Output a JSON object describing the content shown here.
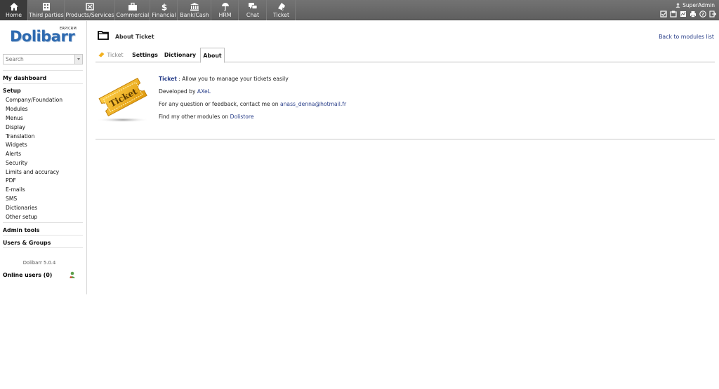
{
  "topmenu": [
    {
      "label": "Home",
      "icon": "home-icon",
      "active": true
    },
    {
      "label": "Third parties",
      "icon": "building-icon"
    },
    {
      "label": "Products/Services",
      "icon": "box-icon"
    },
    {
      "label": "Commercial",
      "icon": "briefcase-icon"
    },
    {
      "label": "Financial",
      "icon": "dollar-icon"
    },
    {
      "label": "Bank/Cash",
      "icon": "bank-icon"
    },
    {
      "label": "HRM",
      "icon": "umbrella-icon"
    },
    {
      "label": "Chat",
      "icon": "chat-icon"
    },
    {
      "label": "Ticket",
      "icon": "ticket-icon"
    }
  ],
  "user": {
    "name": "SuperAdmin"
  },
  "logo": {
    "brand": "Dolibarr",
    "tagline": "ERP/CRM"
  },
  "search": {
    "placeholder": "Search"
  },
  "leftmenu": {
    "dashboard": "My dashboard",
    "setup": "Setup",
    "setup_items": [
      "Company/Foundation",
      "Modules",
      "Menus",
      "Display",
      "Translation",
      "Widgets",
      "Alerts",
      "Security",
      "Limits and accuracy",
      "PDF",
      "E-mails",
      "SMS",
      "Dictionaries",
      "Other setup"
    ],
    "admin_tools": "Admin tools",
    "users_groups": "Users & Groups",
    "version": "Dolibarr 5.0.4",
    "online_users": "Online users (0)"
  },
  "page": {
    "title": "About Ticket",
    "back_link": "Back to modules list",
    "tabs": {
      "module": "Ticket",
      "settings": "Settings",
      "dictionary": "Dictionary",
      "about": "About"
    },
    "image_text": "Ticket",
    "info": {
      "module_name": "Ticket",
      "description": " : Allow you to manage your tickets easily",
      "developed_by": "Developed by ",
      "developer": "AXeL",
      "feedback": "For any question or feedback, contact me on ",
      "email": "anass_denna@hotmail.fr",
      "other_modules": "Find my other modules on ",
      "store": "Dolistore"
    }
  },
  "colors": {
    "topbar": "#666666",
    "link": "#263c88",
    "brand": "#2e6ab0",
    "ticket": "#f2b01e"
  }
}
